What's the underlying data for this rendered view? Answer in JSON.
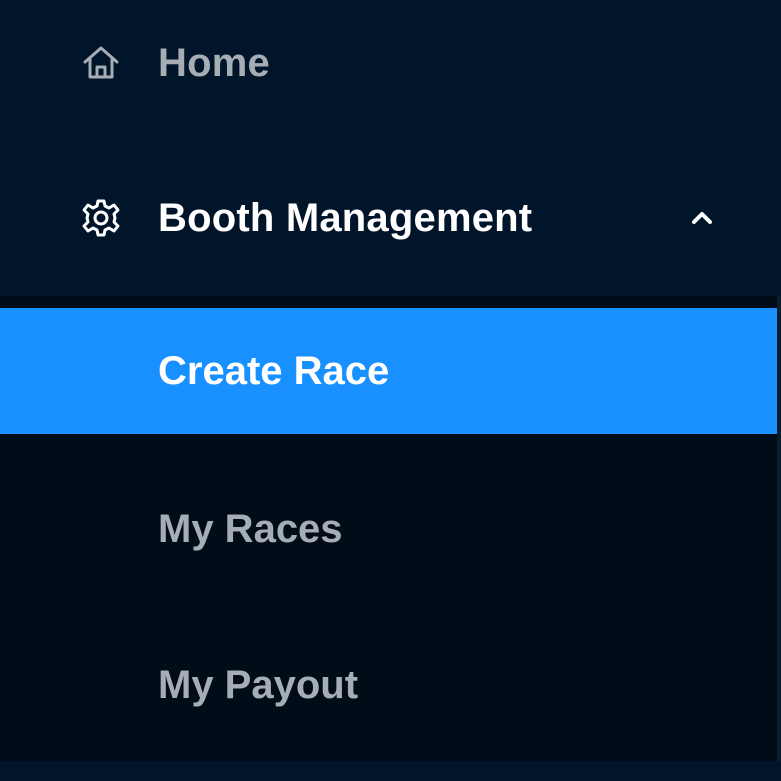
{
  "menu": {
    "home": {
      "label": "Home",
      "icon": "home-icon"
    },
    "booth_management": {
      "label": "Booth Management",
      "icon": "gear-icon",
      "expanded": true,
      "chevron_icon": "chevron-up-icon"
    },
    "submenu": [
      {
        "label": "Create Race",
        "selected": true
      },
      {
        "label": "My Races",
        "selected": false
      },
      {
        "label": "My Payout",
        "selected": false
      }
    ]
  },
  "colors": {
    "sidebar_bg": "#001529",
    "submenu_bg": "#000c17",
    "selected_bg": "#1890ff",
    "text_muted": "#a6adb4",
    "text_active": "#ffffff"
  }
}
